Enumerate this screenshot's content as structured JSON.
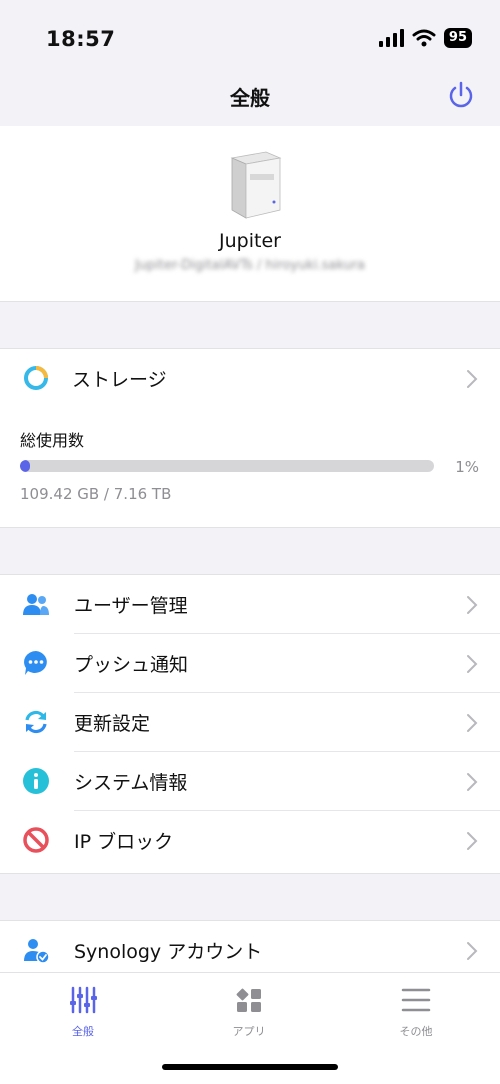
{
  "status": {
    "time": "18:57",
    "battery": "95"
  },
  "nav": {
    "title": "全般"
  },
  "device": {
    "name": "Jupiter",
    "subtitle": "Jupiter-DigitalAVTs / hiroyuki.sakura"
  },
  "storage": {
    "label": "ストレージ",
    "usage_title": "総使用数",
    "usage_percent_text": "1%",
    "usage_fraction": 0.015,
    "usage_detail": "109.42 GB / 7.16 TB"
  },
  "menu": [
    {
      "label": "ユーザー管理",
      "icon": "users-icon"
    },
    {
      "label": "プッシュ通知",
      "icon": "chat-bubble-icon"
    },
    {
      "label": "更新設定",
      "icon": "refresh-icon"
    },
    {
      "label": "システム情報",
      "icon": "info-icon"
    },
    {
      "label": "IP ブロック",
      "icon": "block-icon"
    }
  ],
  "account": {
    "label": "Synology アカウント"
  },
  "tabs": [
    {
      "label": "全般",
      "active": true
    },
    {
      "label": "アプリ",
      "active": false
    },
    {
      "label": "その他",
      "active": false
    }
  ],
  "colors": {
    "accent": "#5a64e8",
    "background": "#f2f2f7"
  }
}
